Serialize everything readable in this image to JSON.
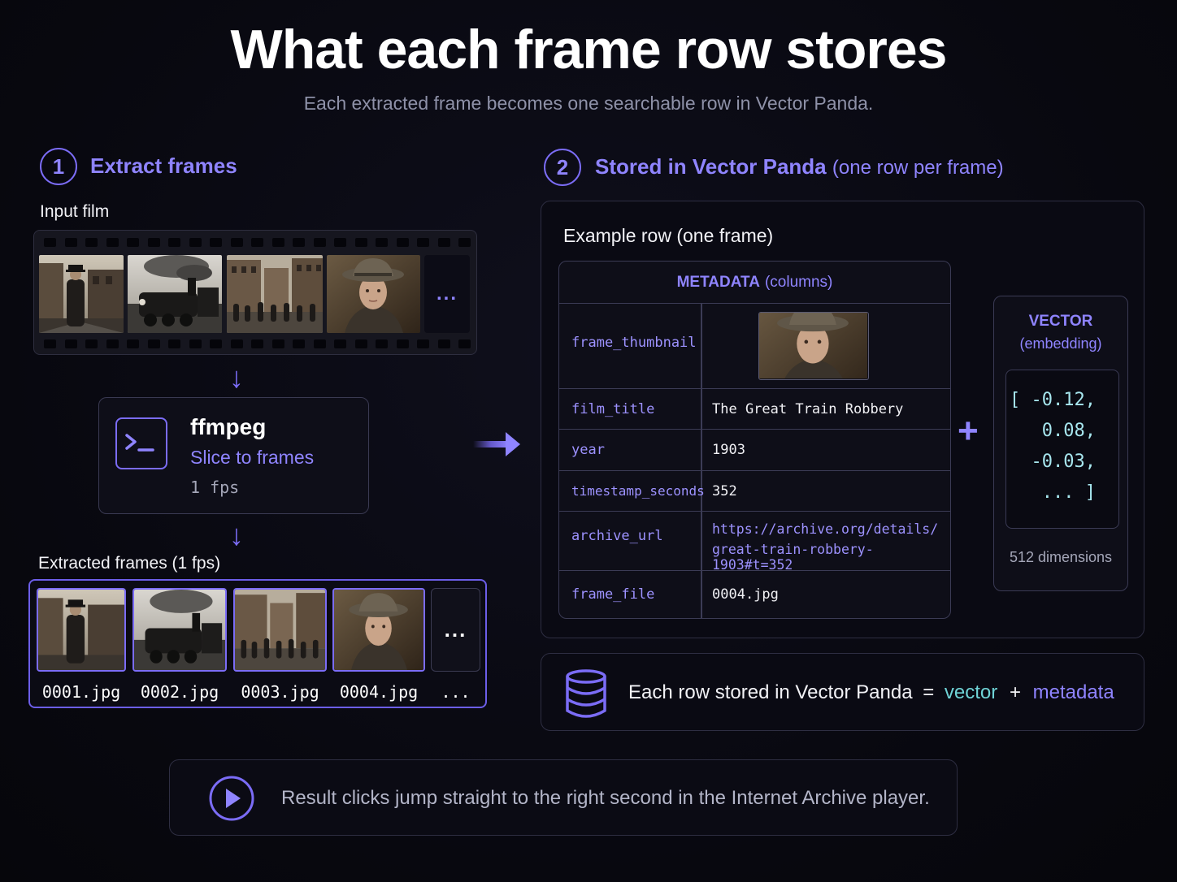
{
  "header": {
    "title": "What each frame row stores",
    "subtitle": "Each extracted frame becomes one searchable row in Vector Panda."
  },
  "step1": {
    "number": "1",
    "label": "Extract frames",
    "input_label": "Input film",
    "more": "...",
    "tool": {
      "name": "ffmpeg",
      "action": "Slice to frames",
      "rate": "1 fps"
    },
    "extracted_label": "Extracted frames (1 fps)",
    "frames": [
      "0001.jpg",
      "0002.jpg",
      "0003.jpg",
      "0004.jpg",
      "..."
    ]
  },
  "step2": {
    "number": "2",
    "label": "Stored in Vector Panda",
    "label_suffix": "(one row per frame)",
    "example_title": "Example row (one frame)",
    "metadata_header": "METADATA",
    "metadata_header_suffix": "(columns)",
    "rows": [
      {
        "key": "frame_thumbnail",
        "value": ""
      },
      {
        "key": "film_title",
        "value": "The Great Train Robbery"
      },
      {
        "key": "year",
        "value": "1903"
      },
      {
        "key": "timestamp_seconds",
        "value": "352"
      },
      {
        "key": "archive_url",
        "value": "https://archive.org/details/",
        "value2": "great-train-robbery-1903#t=352"
      },
      {
        "key": "frame_file",
        "value": "0004.jpg"
      }
    ],
    "plus": "+",
    "vector": {
      "title": "VECTOR",
      "subtitle": "(embedding)",
      "lines": [
        "[ -0.12,",
        "0.08,",
        "-0.03,",
        "... ]"
      ],
      "dimensions": "512 dimensions"
    }
  },
  "summary": {
    "prefix": "Each row stored in Vector Panda",
    "eq": "=",
    "vector": "vector",
    "plus": "+",
    "metadata": "metadata"
  },
  "result": {
    "text": "Result clicks jump straight to the right second in the Internet Archive player."
  },
  "colors": {
    "accent": "#7b6cf6",
    "accent_text": "#8f84ff",
    "teal": "#6fd3d6",
    "background": "#08080f"
  }
}
